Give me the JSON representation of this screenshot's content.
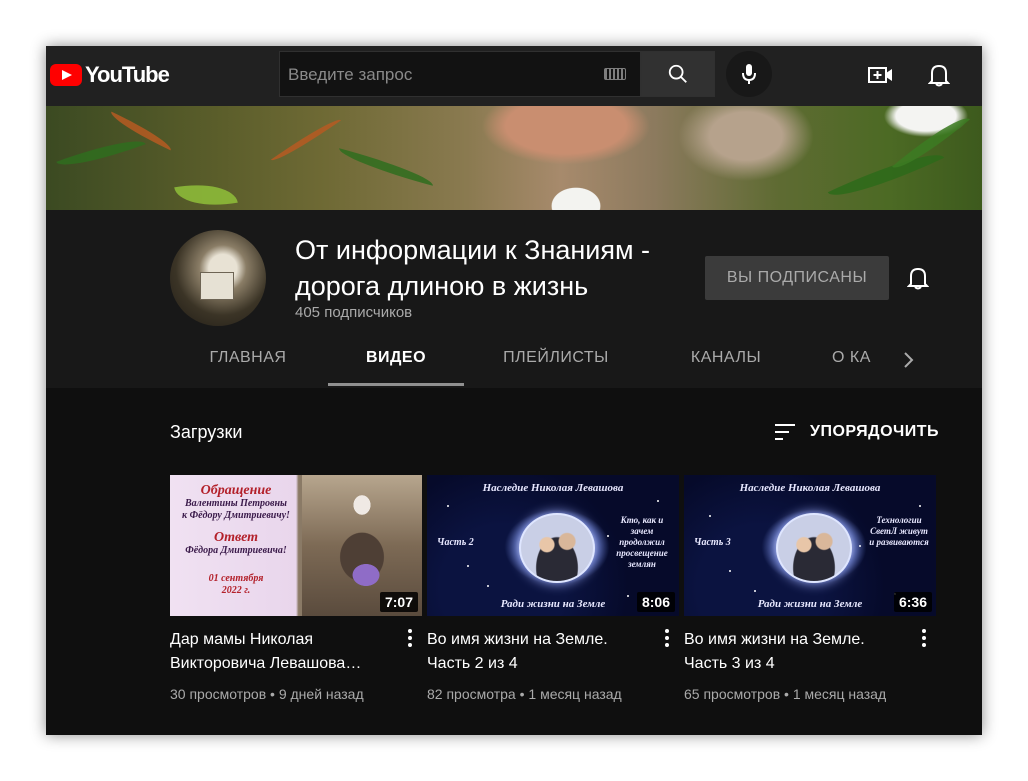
{
  "header": {
    "logo_text": "YouTube",
    "search_placeholder": "Введите запрос",
    "icons": [
      "youtube-logo",
      "keyboard-icon",
      "search-icon",
      "mic-icon",
      "create-video-icon",
      "bell-icon"
    ]
  },
  "channel": {
    "title_line1": "От информации к Знаниям -",
    "title_line2": "дорога длиною в жизнь",
    "subscribers": "405 подписчиков",
    "subscribed_label": "ВЫ ПОДПИСАНЫ"
  },
  "tabs": [
    {
      "label": "ГЛАВНАЯ",
      "active": false
    },
    {
      "label": "ВИДЕО",
      "active": true
    },
    {
      "label": "ПЛЕЙЛИСТЫ",
      "active": false
    },
    {
      "label": "КАНАЛЫ",
      "active": false
    },
    {
      "label": "О КА",
      "active": false
    }
  ],
  "uploads": {
    "section_title": "Загрузки",
    "sort_label": "УПОРЯДОЧИТЬ",
    "videos": [
      {
        "title_line1": "Дар мамы Николая",
        "title_line2": "Викторовича Левашова…",
        "views": "30 просмотров",
        "age": "9 дней назад",
        "duration": "7:07",
        "thumb": {
          "line1": "Обращение",
          "line2": "Валентины Петровны",
          "line3": "к Фёдору Дмитриевичу!",
          "line4": "Ответ",
          "line5": "Фёдора Дмитриевича!",
          "line6": "01 сентября",
          "line7": "2022 г."
        }
      },
      {
        "title_line1": "Во имя жизни на Земле.",
        "title_line2": "Часть 2 из 4",
        "views": "82 просмотра",
        "age": "1 месяц назад",
        "duration": "8:06",
        "thumb": {
          "top": "Наследие Николая Левашова",
          "left": "Часть 2",
          "right": "Кто, как и зачем продолжил просвещение землян",
          "bottom": "Ради жизни на Земле"
        }
      },
      {
        "title_line1": "Во имя жизни на Земле.",
        "title_line2": "Часть 3 из 4",
        "views": "65 просмотров",
        "age": "1 месяц назад",
        "duration": "6:36",
        "thumb": {
          "top": "Наследие Николая Левашова",
          "left": "Часть 3",
          "right": "Технологии СветЛ живут и развиваются",
          "bottom": "Ради жизни на Земле"
        }
      }
    ]
  },
  "colors": {
    "background": "#181818",
    "topbar": "#212121",
    "content": "#0f0f0f",
    "brand_red": "#ff0000",
    "muted_text": "#aaaaaa"
  }
}
